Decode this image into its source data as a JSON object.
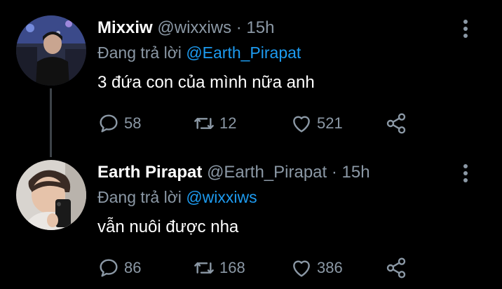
{
  "tweets": [
    {
      "display_name": "Mixxiw",
      "handle": "@wixxiws",
      "separator": " · ",
      "time": "15h",
      "reply_prefix": "Đang trả lời ",
      "reply_mention": "@Earth_Pirapat",
      "text": "3 đứa con của mình nữa anh",
      "replies": "58",
      "retweets": "12",
      "likes": "521"
    },
    {
      "display_name": "Earth Pirapat",
      "handle": "@Earth_Pirapat",
      "separator": " · ",
      "time": "15h",
      "reply_prefix": "Đang trả lời ",
      "reply_mention": "@wixxiws",
      "text": "vẫn nuôi được nha",
      "replies": "86",
      "retweets": "168",
      "likes": "386"
    }
  ],
  "colors": {
    "background": "#000000",
    "text": "#ffffff",
    "secondary": "#8b98a5",
    "link": "#1d9bf0",
    "thread_line": "#3d4248"
  }
}
